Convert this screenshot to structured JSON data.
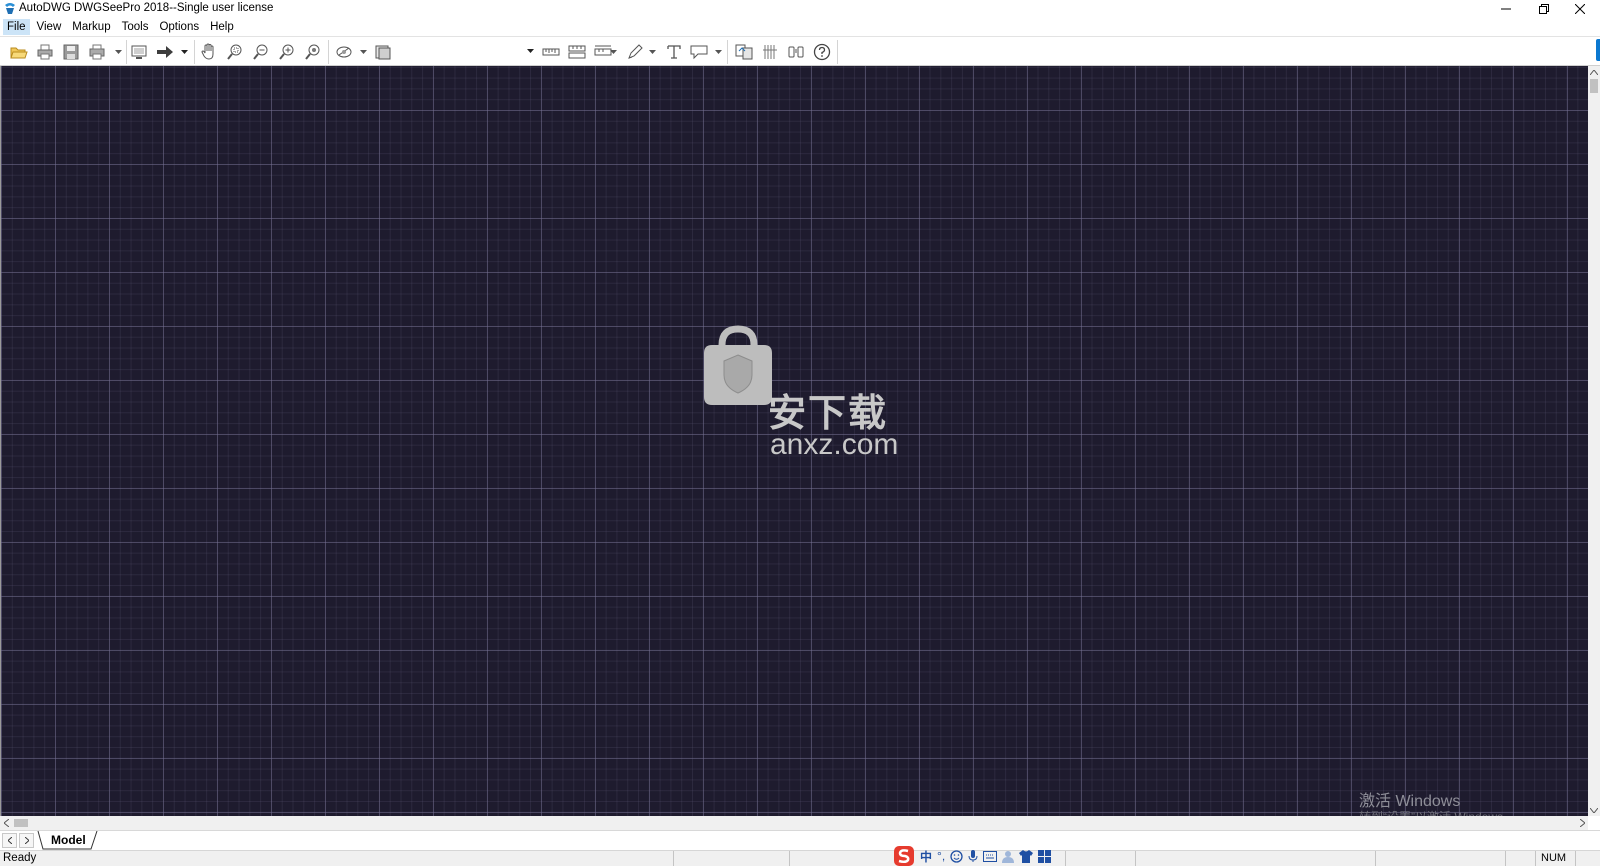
{
  "window": {
    "title": "AutoDWG DWGSeePro 2018--Single user license",
    "controls": [
      "minimize-icon",
      "restore-icon",
      "close-icon"
    ]
  },
  "menu": {
    "items": [
      {
        "label": "File",
        "active": true
      },
      {
        "label": "View"
      },
      {
        "label": "Markup"
      },
      {
        "label": "Tools"
      },
      {
        "label": "Options"
      },
      {
        "label": "Help"
      }
    ]
  },
  "toolbar": {
    "icons": [
      "open-folder-icon",
      "print-icon",
      "save-icon",
      "batch-print-icon",
      "layout-icon",
      "export-arrow-icon",
      "pan-hand-icon",
      "zoom-window-icon",
      "zoom-out-icon",
      "zoom-in-icon",
      "zoom-extents-icon",
      "layer-icon",
      "background-icon",
      "measure-distance-icon",
      "measure-area-icon",
      "measure-dims-icon",
      "pen-markup-icon",
      "text-markup-icon",
      "callout-markup-icon",
      "compare-icon",
      "sidebar-icon",
      "binoculars-icon",
      "help-icon"
    ],
    "combo_value": ""
  },
  "canvas": {
    "background": "#1e1b2e",
    "watermark": {
      "text": "安下载",
      "url": "anxz.com"
    },
    "activation": {
      "title": "激活 Windows",
      "subtitle": "转到“设置”以激活 Windows。"
    }
  },
  "tabs": {
    "items": [
      {
        "label": "Model",
        "active": true
      }
    ]
  },
  "status": {
    "text": "Ready",
    "num_indicator": "NUM",
    "ime": {
      "mode": "中",
      "punct": "°,"
    }
  }
}
